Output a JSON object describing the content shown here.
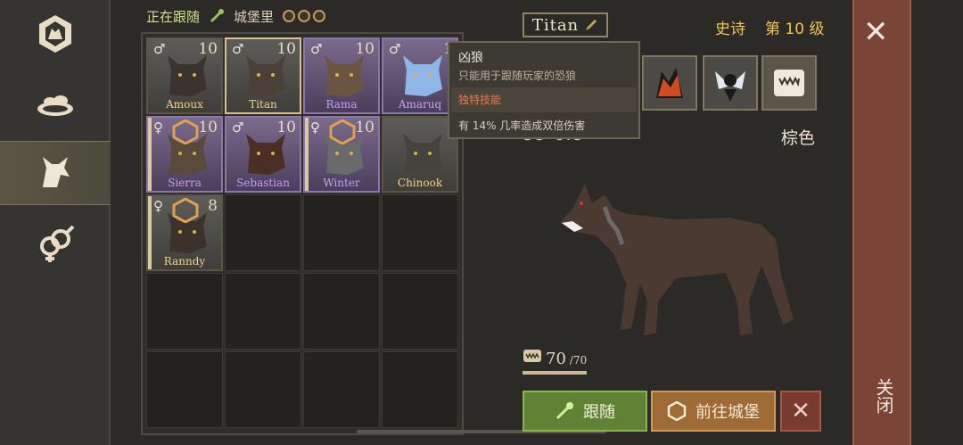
{
  "sidebar": {
    "items": [
      {
        "icon": "wolf-emblem-icon",
        "active": false
      },
      {
        "icon": "food-bowl-icon",
        "active": false
      },
      {
        "icon": "wolf-icon",
        "active": true
      },
      {
        "icon": "breeding-icon",
        "active": false
      }
    ]
  },
  "topbar": {
    "following_label": "正在跟随",
    "castle_label": "城堡里"
  },
  "grid": {
    "wolves": [
      {
        "name": "Amoux",
        "level": "10",
        "sex": "♂",
        "rarity": "normal",
        "selected": false
      },
      {
        "name": "Titan",
        "level": "10",
        "sex": "♂",
        "rarity": "normal",
        "selected": true
      },
      {
        "name": "Rama",
        "level": "10",
        "sex": "♂",
        "rarity": "epic",
        "selected": false
      },
      {
        "name": "Amaruq",
        "level": "1",
        "sex": "♂",
        "rarity": "epic",
        "selected": false
      },
      {
        "name": "Sierra",
        "level": "10",
        "sex": "♀",
        "rarity": "epic",
        "selected": false
      },
      {
        "name": "Sebastian",
        "level": "10",
        "sex": "♂",
        "rarity": "epic",
        "selected": false
      },
      {
        "name": "Winter",
        "level": "10",
        "sex": "♀",
        "rarity": "epic",
        "selected": false
      },
      {
        "name": "Chinook",
        "level": "",
        "sex": "",
        "rarity": "normal",
        "selected": false
      },
      {
        "name": "Ranndy",
        "level": "8",
        "sex": "♀",
        "rarity": "normal",
        "selected": false
      }
    ]
  },
  "tooltip": {
    "title": "凶狼",
    "description": "只能用于跟随玩家的恐狼",
    "skill_header": "独特技能",
    "effect": "有 14% 几率造成双倍伤害"
  },
  "detail": {
    "name": "Titan",
    "rarity": "史诗",
    "level": "第 10 级",
    "stats": [
      "99",
      "0.8"
    ],
    "color": "棕色",
    "hunger_value": "70",
    "hunger_max": "/70",
    "hunger_fraction": 1.0
  },
  "buttons": {
    "follow": "跟随",
    "to_castle": "前往城堡",
    "release": "✕"
  },
  "close": {
    "x": "✕",
    "label": "关闭"
  },
  "colors": {
    "epic_rarity": "#f2c552",
    "follow_green": "#5f8234",
    "castle_orange": "#9e6a35",
    "close_red": "#7b4535"
  }
}
